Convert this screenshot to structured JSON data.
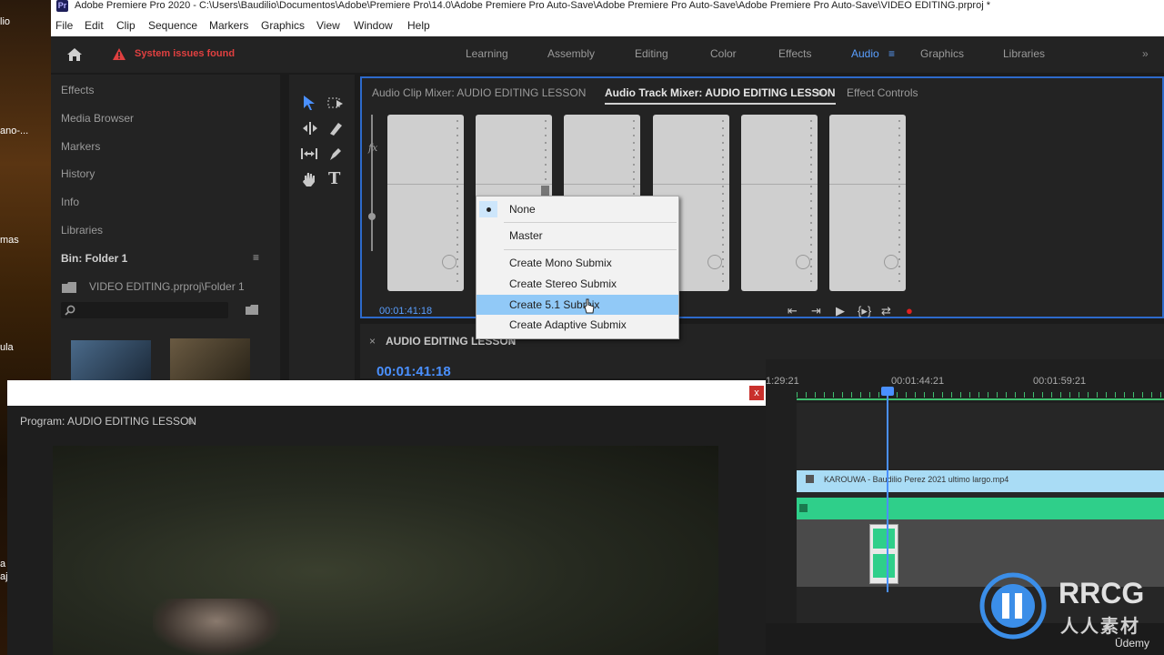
{
  "window": {
    "title": "Adobe Premiere Pro 2020 - C:\\Users\\Baudilio\\Documentos\\Adobe\\Premiere Pro\\14.0\\Adobe Premiere Pro Auto-Save\\Adobe Premiere Pro Auto-Save\\Adobe Premiere Pro Auto-Save\\VIDEO EDITING.prproj *",
    "logo": "Pr"
  },
  "menubar": [
    "File",
    "Edit",
    "Clip",
    "Sequence",
    "Markers",
    "Graphics",
    "View",
    "Window",
    "Help"
  ],
  "header": {
    "alert": "System issues found",
    "workspaces": [
      "Learning",
      "Assembly",
      "Editing",
      "Color",
      "Effects",
      "Audio",
      "Graphics",
      "Libraries"
    ],
    "active_workspace": "Audio"
  },
  "left_panel": {
    "items": [
      "Effects",
      "Media Browser",
      "Markers",
      "History",
      "Info",
      "Libraries"
    ],
    "bin_title": "Bin: Folder 1",
    "bin_path": "VIDEO EDITING.prproj\\Folder 1"
  },
  "mixer": {
    "tabs": [
      "Audio Clip Mixer: AUDIO EDITING LESSON",
      "Audio Track Mixer: AUDIO EDITING LESSON",
      "Effect Controls"
    ],
    "fx_label": "fx",
    "timecode": "00:01:41:18"
  },
  "context_menu": {
    "items": [
      "None",
      "Master",
      "Create Mono Submix",
      "Create Stereo Submix",
      "Create 5.1 Submix",
      "Create Adaptive Submix"
    ],
    "selected": "None",
    "highlighted": "Create 5.1 Submix"
  },
  "sequence": {
    "title": "AUDIO EDITING LESSON",
    "timecode": "00:01:41:18",
    "ruler": [
      "1:29:21",
      "00:01:44:21",
      "00:01:59:21"
    ],
    "clip_name": "KAROUWA - Baudilio Perez 2021 ultimo largo.mp4"
  },
  "program": {
    "title": "Program: AUDIO EDITING LESSON",
    "close": "x"
  },
  "desktop": {
    "labels": [
      "lio",
      "ano-...",
      "mas",
      "ula",
      "a",
      "aje"
    ]
  },
  "watermark": {
    "brand": "RRCG",
    "sub": "人人素材",
    "udemy": "Ūdemy"
  },
  "colors": {
    "accent": "#2d6acb",
    "highlight": "#91c9f7",
    "alert": "#e04040",
    "audio_track": "#2fcf8a",
    "video_clip": "#a9dcf5"
  }
}
